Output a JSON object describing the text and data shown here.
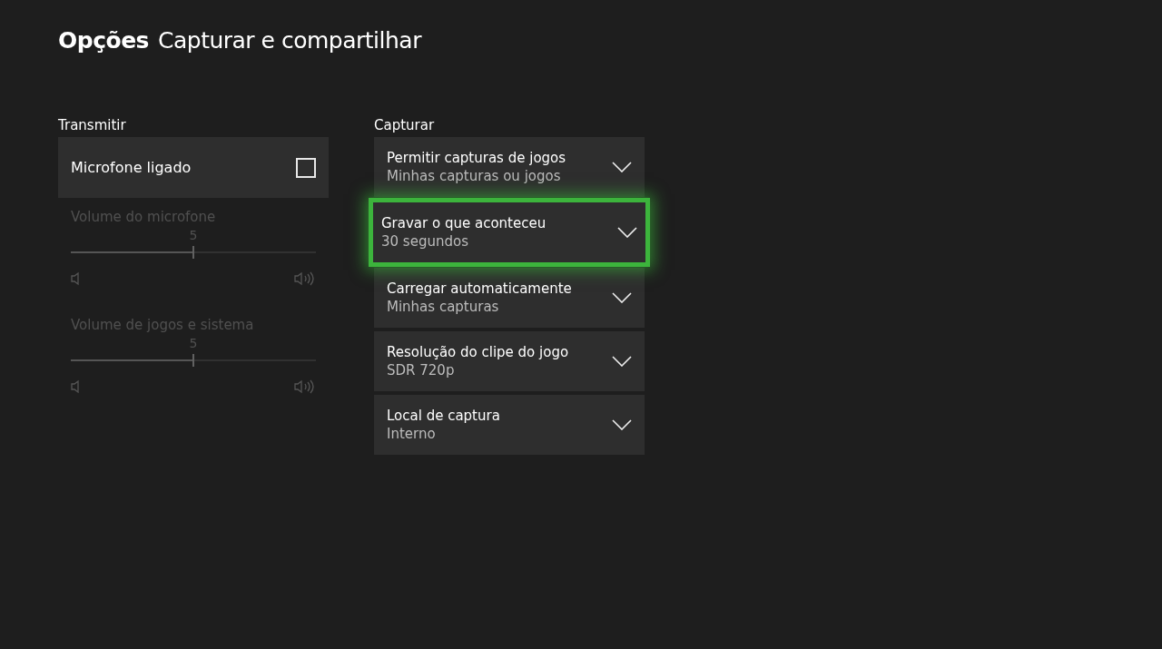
{
  "header": {
    "section": "Opções",
    "title": "Capturar e compartilhar"
  },
  "broadcast": {
    "heading": "Transmitir",
    "toggle": {
      "label": "Microfone ligado",
      "checked": false
    },
    "sliders": [
      {
        "label": "Volume do microfone",
        "reading": "5",
        "level": 0.5,
        "disabled": true
      },
      {
        "label": "Volume de jogos e sistema",
        "reading": "5",
        "level": 0.5,
        "disabled": true
      }
    ]
  },
  "capture": {
    "heading": "Capturar",
    "options": [
      {
        "label": "Permitir capturas de jogos",
        "value": "Minhas capturas ou jogos",
        "selected": false
      },
      {
        "label": "Gravar o que aconteceu",
        "value": "30 segundos",
        "selected": true
      },
      {
        "label": "Carregar automaticamente",
        "value": "Minhas capturas",
        "selected": false
      },
      {
        "label": "Resolução do clipe do jogo",
        "value": "SDR 720p",
        "selected": false
      },
      {
        "label": "Local de captura",
        "value": "Interno",
        "selected": false
      }
    ]
  }
}
